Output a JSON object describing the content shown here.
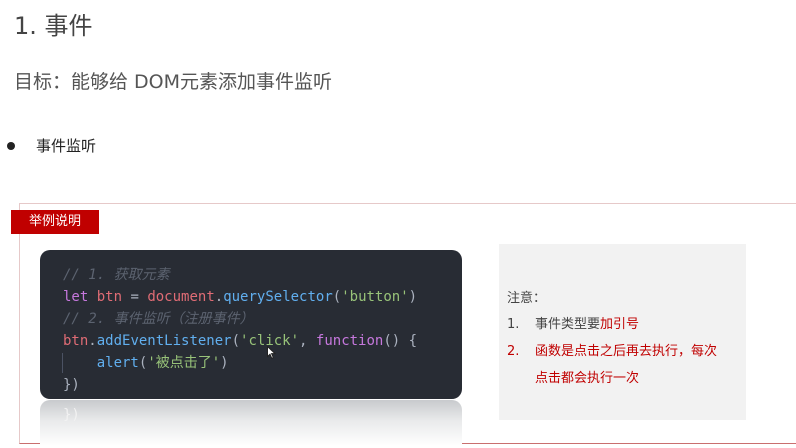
{
  "heading": "1. 事件",
  "goal": "目标：能够给 DOM元素添加事件监听",
  "bullet": "事件监听",
  "example_tag": "举例说明",
  "code": {
    "comment1": "// 1. 获取元素",
    "line2": {
      "kw": "let",
      "var": "btn",
      "eq": " = ",
      "obj": "document",
      "dot": ".",
      "method": "querySelector",
      "open": "(",
      "arg": "'button'",
      "close": ")"
    },
    "comment2": "// 2. 事件监听（注册事件）",
    "line4": {
      "obj": "btn",
      "dot": ".",
      "method": "addEventListener",
      "open": "(",
      "arg": "'click'",
      "sep": ", ",
      "kw": "function",
      "rest": "() {"
    },
    "line5": {
      "fn": "alert",
      "open": "(",
      "arg": "'被点击了'",
      "close": ")"
    },
    "line6": "})"
  },
  "reflection": {
    "line1": "})"
  },
  "note": {
    "title": "注意：",
    "item1_num": "1.",
    "item1_text": "事件类型要",
    "item1_highlight": "加引号",
    "item2_num": "2.",
    "item2_text_line1": "函数是点击之后再去执行，每次",
    "item2_text_line2": "点击都会执行一次"
  }
}
